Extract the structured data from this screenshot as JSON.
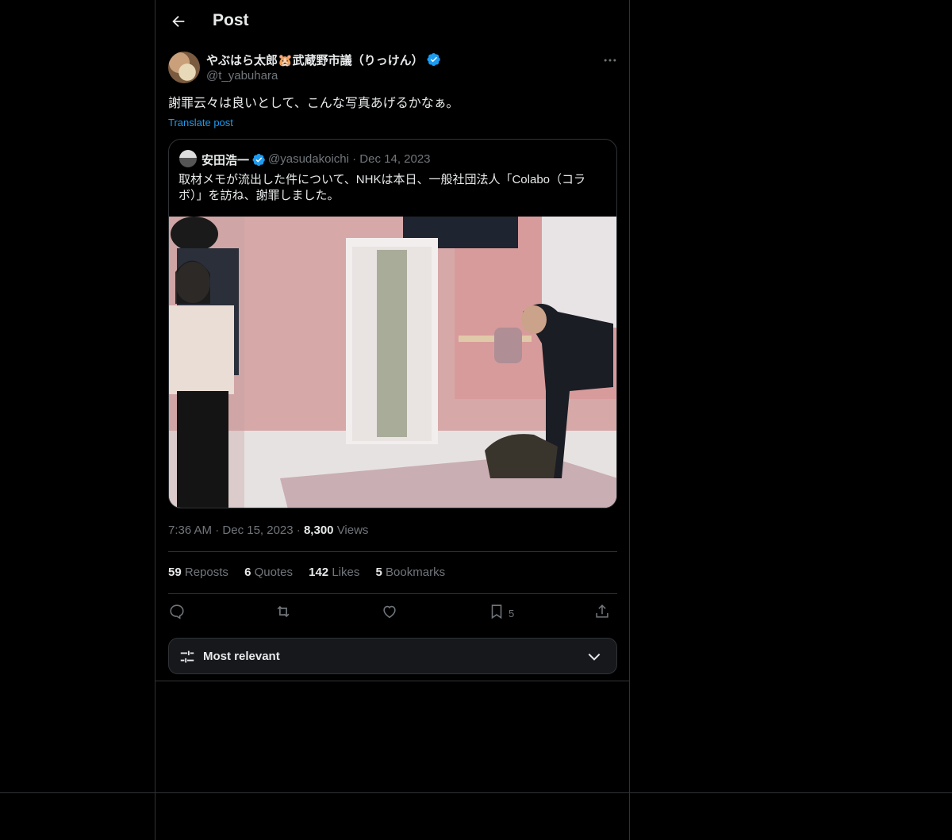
{
  "header": {
    "title": "Post"
  },
  "post": {
    "author_name": "やぶはら太郎🐹武蔵野市議（りっけん）",
    "handle": "@t_yabuhara",
    "text": "謝罪云々は良いとして、こんな写真あげるかなぁ。",
    "translate_label": "Translate post",
    "time": "7:36 AM",
    "date": "Dec 15, 2023",
    "views_count": "8,300",
    "views_label": "Views"
  },
  "quote": {
    "author_name": "安田浩一",
    "handle": "@yasudakoichi",
    "date": "Dec 14, 2023",
    "text": "取材メモが流出した件について、NHKは本日、一般社団法人「Colabo（コラボ）」を訪ね、謝罪しました。"
  },
  "stats": {
    "reposts_count": "59",
    "reposts_label": "Reposts",
    "quotes_count": "6",
    "quotes_label": "Quotes",
    "likes_count": "142",
    "likes_label": "Likes",
    "bookmarks_count": "5",
    "bookmarks_label": "Bookmarks"
  },
  "actions": {
    "bookmark_count": "5"
  },
  "sort": {
    "label": "Most relevant"
  },
  "colors": {
    "accent": "#1d9bf0",
    "border": "#2f3336",
    "muted": "#71767b"
  }
}
